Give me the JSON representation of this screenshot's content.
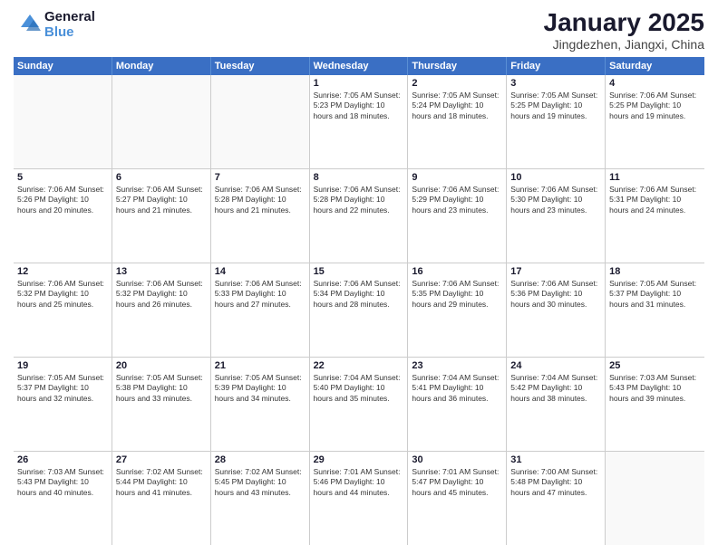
{
  "header": {
    "logo_line1": "General",
    "logo_line2": "Blue",
    "main_title": "January 2025",
    "subtitle": "Jingdezhen, Jiangxi, China"
  },
  "weekdays": [
    "Sunday",
    "Monday",
    "Tuesday",
    "Wednesday",
    "Thursday",
    "Friday",
    "Saturday"
  ],
  "weeks": [
    [
      {
        "day": "",
        "info": "",
        "empty": true
      },
      {
        "day": "",
        "info": "",
        "empty": true
      },
      {
        "day": "",
        "info": "",
        "empty": true
      },
      {
        "day": "1",
        "info": "Sunrise: 7:05 AM\nSunset: 5:23 PM\nDaylight: 10 hours\nand 18 minutes.",
        "empty": false
      },
      {
        "day": "2",
        "info": "Sunrise: 7:05 AM\nSunset: 5:24 PM\nDaylight: 10 hours\nand 18 minutes.",
        "empty": false
      },
      {
        "day": "3",
        "info": "Sunrise: 7:05 AM\nSunset: 5:25 PM\nDaylight: 10 hours\nand 19 minutes.",
        "empty": false
      },
      {
        "day": "4",
        "info": "Sunrise: 7:06 AM\nSunset: 5:25 PM\nDaylight: 10 hours\nand 19 minutes.",
        "empty": false
      }
    ],
    [
      {
        "day": "5",
        "info": "Sunrise: 7:06 AM\nSunset: 5:26 PM\nDaylight: 10 hours\nand 20 minutes.",
        "empty": false
      },
      {
        "day": "6",
        "info": "Sunrise: 7:06 AM\nSunset: 5:27 PM\nDaylight: 10 hours\nand 21 minutes.",
        "empty": false
      },
      {
        "day": "7",
        "info": "Sunrise: 7:06 AM\nSunset: 5:28 PM\nDaylight: 10 hours\nand 21 minutes.",
        "empty": false
      },
      {
        "day": "8",
        "info": "Sunrise: 7:06 AM\nSunset: 5:28 PM\nDaylight: 10 hours\nand 22 minutes.",
        "empty": false
      },
      {
        "day": "9",
        "info": "Sunrise: 7:06 AM\nSunset: 5:29 PM\nDaylight: 10 hours\nand 23 minutes.",
        "empty": false
      },
      {
        "day": "10",
        "info": "Sunrise: 7:06 AM\nSunset: 5:30 PM\nDaylight: 10 hours\nand 23 minutes.",
        "empty": false
      },
      {
        "day": "11",
        "info": "Sunrise: 7:06 AM\nSunset: 5:31 PM\nDaylight: 10 hours\nand 24 minutes.",
        "empty": false
      }
    ],
    [
      {
        "day": "12",
        "info": "Sunrise: 7:06 AM\nSunset: 5:32 PM\nDaylight: 10 hours\nand 25 minutes.",
        "empty": false
      },
      {
        "day": "13",
        "info": "Sunrise: 7:06 AM\nSunset: 5:32 PM\nDaylight: 10 hours\nand 26 minutes.",
        "empty": false
      },
      {
        "day": "14",
        "info": "Sunrise: 7:06 AM\nSunset: 5:33 PM\nDaylight: 10 hours\nand 27 minutes.",
        "empty": false
      },
      {
        "day": "15",
        "info": "Sunrise: 7:06 AM\nSunset: 5:34 PM\nDaylight: 10 hours\nand 28 minutes.",
        "empty": false
      },
      {
        "day": "16",
        "info": "Sunrise: 7:06 AM\nSunset: 5:35 PM\nDaylight: 10 hours\nand 29 minutes.",
        "empty": false
      },
      {
        "day": "17",
        "info": "Sunrise: 7:06 AM\nSunset: 5:36 PM\nDaylight: 10 hours\nand 30 minutes.",
        "empty": false
      },
      {
        "day": "18",
        "info": "Sunrise: 7:05 AM\nSunset: 5:37 PM\nDaylight: 10 hours\nand 31 minutes.",
        "empty": false
      }
    ],
    [
      {
        "day": "19",
        "info": "Sunrise: 7:05 AM\nSunset: 5:37 PM\nDaylight: 10 hours\nand 32 minutes.",
        "empty": false
      },
      {
        "day": "20",
        "info": "Sunrise: 7:05 AM\nSunset: 5:38 PM\nDaylight: 10 hours\nand 33 minutes.",
        "empty": false
      },
      {
        "day": "21",
        "info": "Sunrise: 7:05 AM\nSunset: 5:39 PM\nDaylight: 10 hours\nand 34 minutes.",
        "empty": false
      },
      {
        "day": "22",
        "info": "Sunrise: 7:04 AM\nSunset: 5:40 PM\nDaylight: 10 hours\nand 35 minutes.",
        "empty": false
      },
      {
        "day": "23",
        "info": "Sunrise: 7:04 AM\nSunset: 5:41 PM\nDaylight: 10 hours\nand 36 minutes.",
        "empty": false
      },
      {
        "day": "24",
        "info": "Sunrise: 7:04 AM\nSunset: 5:42 PM\nDaylight: 10 hours\nand 38 minutes.",
        "empty": false
      },
      {
        "day": "25",
        "info": "Sunrise: 7:03 AM\nSunset: 5:43 PM\nDaylight: 10 hours\nand 39 minutes.",
        "empty": false
      }
    ],
    [
      {
        "day": "26",
        "info": "Sunrise: 7:03 AM\nSunset: 5:43 PM\nDaylight: 10 hours\nand 40 minutes.",
        "empty": false
      },
      {
        "day": "27",
        "info": "Sunrise: 7:02 AM\nSunset: 5:44 PM\nDaylight: 10 hours\nand 41 minutes.",
        "empty": false
      },
      {
        "day": "28",
        "info": "Sunrise: 7:02 AM\nSunset: 5:45 PM\nDaylight: 10 hours\nand 43 minutes.",
        "empty": false
      },
      {
        "day": "29",
        "info": "Sunrise: 7:01 AM\nSunset: 5:46 PM\nDaylight: 10 hours\nand 44 minutes.",
        "empty": false
      },
      {
        "day": "30",
        "info": "Sunrise: 7:01 AM\nSunset: 5:47 PM\nDaylight: 10 hours\nand 45 minutes.",
        "empty": false
      },
      {
        "day": "31",
        "info": "Sunrise: 7:00 AM\nSunset: 5:48 PM\nDaylight: 10 hours\nand 47 minutes.",
        "empty": false
      },
      {
        "day": "",
        "info": "",
        "empty": true
      }
    ]
  ]
}
